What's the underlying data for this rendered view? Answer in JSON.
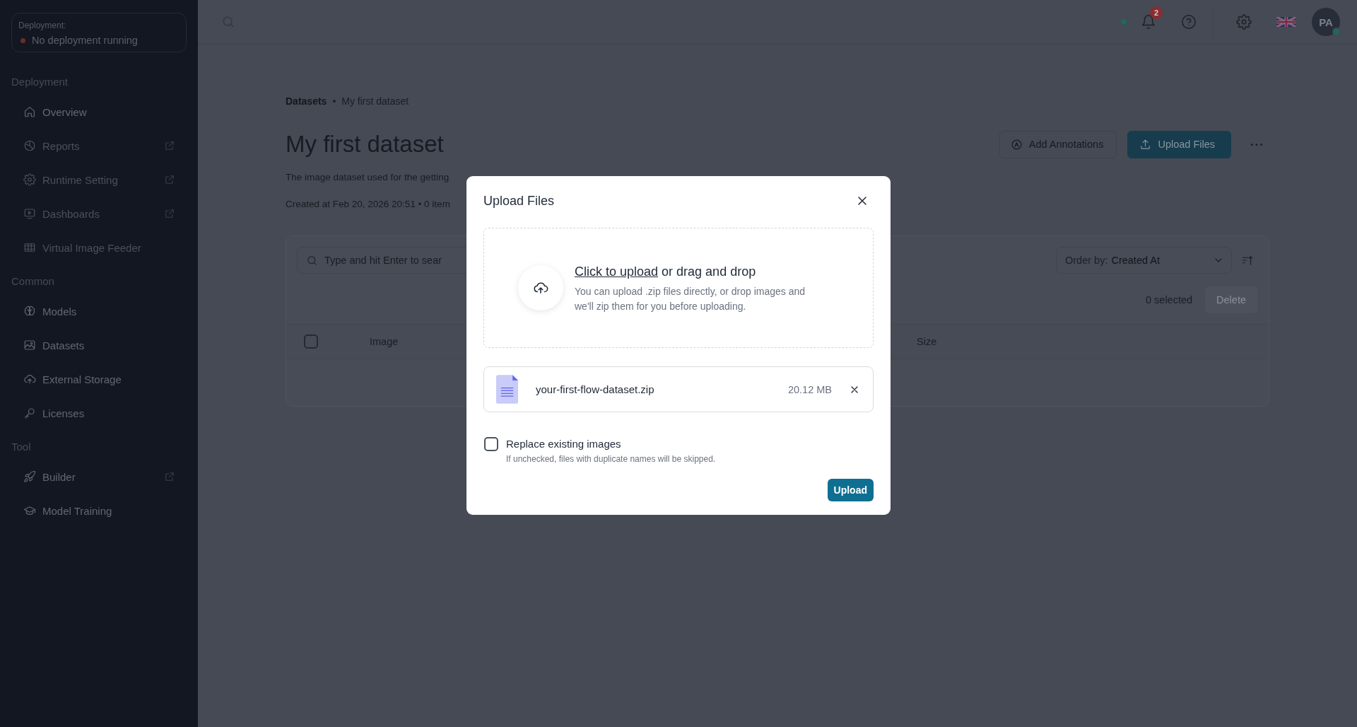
{
  "sidebar": {
    "deployment": {
      "label": "Deployment:",
      "status": "No deployment running",
      "running": false
    },
    "sections": [
      {
        "title": "Deployment",
        "items": [
          {
            "label": "Overview",
            "disabled": false,
            "external": false
          },
          {
            "label": "Reports",
            "disabled": true,
            "external": true
          },
          {
            "label": "Runtime Setting",
            "disabled": true,
            "external": true
          },
          {
            "label": "Dashboards",
            "disabled": true,
            "external": true
          },
          {
            "label": "Virtual Image Feeder",
            "disabled": true,
            "external": false
          }
        ]
      },
      {
        "title": "Common",
        "items": [
          {
            "label": "Models",
            "disabled": false,
            "external": false
          },
          {
            "label": "Datasets",
            "disabled": false,
            "external": false
          },
          {
            "label": "External Storage",
            "disabled": false,
            "external": false
          },
          {
            "label": "Licenses",
            "disabled": false,
            "external": false
          }
        ]
      },
      {
        "title": "Tool",
        "items": [
          {
            "label": "Builder",
            "disabled": false,
            "external": true
          },
          {
            "label": "Model Training",
            "disabled": false,
            "external": false
          }
        ]
      }
    ]
  },
  "topbar": {
    "notification_count": "2",
    "avatar_initials": "PA"
  },
  "breadcrumb": {
    "separator": "•",
    "items": [
      {
        "label": "Datasets",
        "current": false
      },
      {
        "label": "My first dataset",
        "current": true
      }
    ]
  },
  "page": {
    "title": "My first dataset",
    "description": "The image dataset used for the getting",
    "meta": "Created at Feb 20, 2026 20:51 • 0 item",
    "actions": [
      {
        "label": "Add Annotations",
        "kind": "secondary"
      },
      {
        "label": "Upload Files",
        "kind": "primary"
      }
    ]
  },
  "toolbar": {
    "search": {
      "placeholder": "Type and hit Enter to sear"
    },
    "order_by": {
      "label": "Order by:",
      "value": "Created At"
    },
    "selected_count": "0 selected",
    "delete": {
      "label": "Delete",
      "disabled": true
    }
  },
  "table": {
    "select_all_checked": false,
    "columns": [
      {
        "label": "Image"
      },
      {
        "label": "Size"
      }
    ]
  },
  "modal": {
    "title": "Upload Files",
    "dropzone": {
      "link": "Click to upload",
      "text": "or drag and drop",
      "hint": "You can upload .zip files directly, or drop images and we'll zip them for you before uploading."
    },
    "files": [
      {
        "name": "your-first-flow-dataset.zip",
        "size": "20.12 MB"
      }
    ],
    "replace_option": {
      "label": "Replace existing images",
      "help": "If unchecked, files with duplicate names will be skipped.",
      "checked": false
    },
    "submit": {
      "label": "Upload"
    }
  }
}
